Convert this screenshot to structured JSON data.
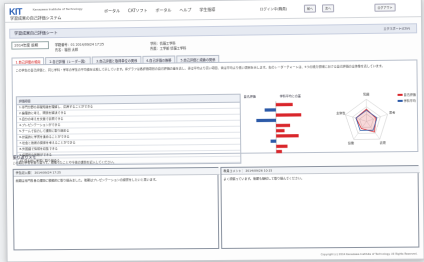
{
  "header": {
    "logo_text": "KIT",
    "logo_sub": "Kanazawa Institute of Technology",
    "app_name": "学習成果の自己評価システム",
    "nav": [
      "ポータル",
      "CATソフト",
      "ポータル",
      "ヘルプ",
      "学生指導"
    ],
    "role": "ログイン中(職員)",
    "buttons": [
      "前へ",
      "次へ",
      "ログアウト"
    ]
  },
  "title_bar": {
    "title": "学習成果自己評価シート",
    "export_label": "エクスポート(CSV)"
  },
  "controls": {
    "year_select": "2014年度 前期",
    "info": [
      "学籍番号：01  2014/09/24 17:25",
      "氏名：福田 太郎",
      "学科：情報工学科",
      "所属：工学部 情報工学科"
    ]
  },
  "tabs": [
    {
      "label": "1.自己評価の傾向",
      "active": true
    },
    {
      "label": "2.自己評価（レーダー図）",
      "active": false
    },
    {
      "label": "3.自己評価と取得単位の関係",
      "active": false
    },
    {
      "label": "4.自己評価の推移",
      "active": false
    },
    {
      "label": "5.自己評価と成績の関係",
      "active": false
    }
  ],
  "description": "この学生の自己評価と、同じ学科・学年の学生の平均値を比較して示しています。棒グラフは各評価項目の自己評価の差を表し、赤は平均より高い項目、青は平均より低い項目を示します。右のレーダーチャートは、5つの能力領域における自己評価の全体像を表しています。",
  "table": {
    "header_item": "評価項目",
    "header_self": "自己評価",
    "header_avg": "学科平均との差",
    "rows": [
      "1.専門分野の基礎知識を理解し、応用することができる",
      "2.論理的に考え、問題を解決できる",
      "3.自分の考えを文章で表現できる",
      "4.プレゼンテーションができる",
      "5.チームで協力して課題に取り組める",
      "6.計画的に学習を進めることができる",
      "7.社会と技術の関係を考えることができる",
      "8.外国語で情報を収集できる",
      "9.倫理的な判断ができる",
      "10.自主的に学習に取り組める"
    ]
  },
  "bar_values": [
    0.6,
    -0.4,
    0.9,
    -0.7,
    0.5,
    0.3,
    0.8,
    -0.2,
    0.4,
    0.2
  ],
  "radar": {
    "labels": [
      "知識",
      "思考",
      "表現",
      "協働",
      "主体性"
    ],
    "series": [
      {
        "name": "自己評価",
        "color": "#d9262b",
        "values": [
          0.55,
          0.45,
          0.6,
          0.4,
          0.5
        ]
      },
      {
        "name": "学科平均",
        "color": "#2c5aa8",
        "values": [
          0.5,
          0.5,
          0.5,
          0.5,
          0.5
        ]
      }
    ]
  },
  "free": {
    "heading": "振り返りメモ",
    "note": "この期の学習を振り返って、頑張ったことや今後の課題を記入してください。",
    "left_header": "学生記入欄：  2014/09/24 17:25",
    "left_text": "前期は専門科目の課題に積極的に取り組みました。後期はプレゼンテーションの練習をしたいと思います。",
    "right_header": "教員コメント：  2014/09/26 10:15",
    "right_text": "よく頑張っています。後期も継続して取り組んでください。"
  },
  "footer": "Copyright (c) 2014 Kanazawa Institute of Technology. All Rights Reserved."
}
